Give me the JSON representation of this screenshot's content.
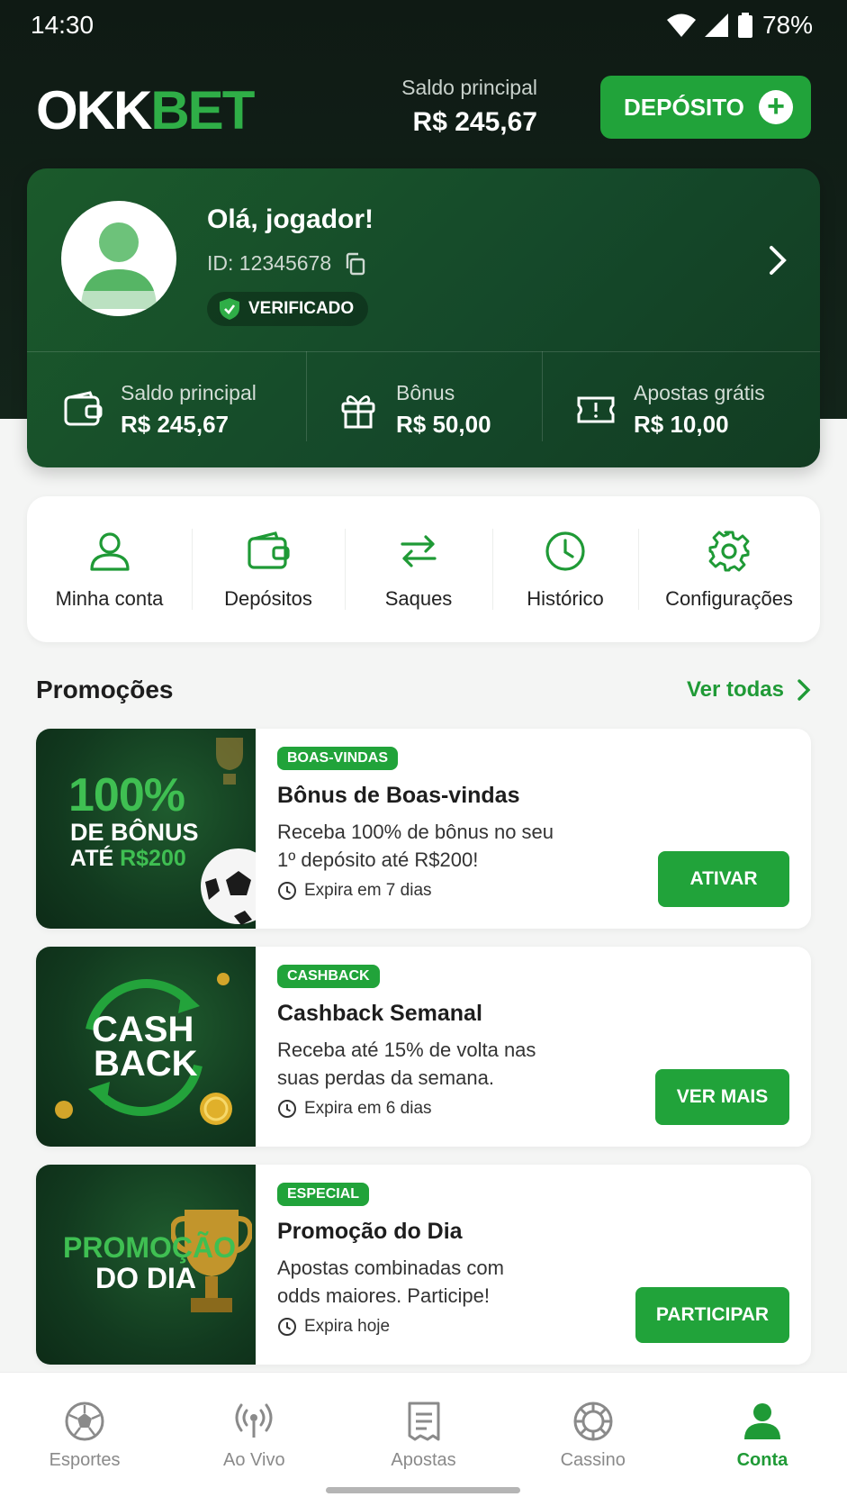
{
  "status_bar": {
    "time": "14:30",
    "battery": "78%"
  },
  "brand": {
    "logo_part1": "OKK",
    "logo_part2": "BET",
    "accent_color": "#21a33a",
    "header_color": "#13241a"
  },
  "header": {
    "balance_label": "Saldo principal",
    "balance_value": "R$ 245,67",
    "deposit_label": "DEPÓSITO"
  },
  "profile": {
    "greeting": "Olá, jogador!",
    "id": "ID: 12345678",
    "verified": "VERIFICADO",
    "wallets": [
      {
        "label": "Saldo principal",
        "value": "R$ 245,67",
        "icon": "wallet-icon"
      },
      {
        "label": "Bônus",
        "value": "R$ 50,00",
        "icon": "gift-icon"
      },
      {
        "label": "Apostas grátis",
        "value": "R$ 10,00",
        "icon": "ticket-icon"
      }
    ]
  },
  "menu": [
    {
      "label": "Minha conta",
      "icon": "user-icon"
    },
    {
      "label": "Depósitos",
      "icon": "wallet-icon"
    },
    {
      "label": "Saques",
      "icon": "transfer-arrows-icon"
    },
    {
      "label": "Histórico",
      "icon": "clock-icon"
    },
    {
      "label": "Configurações",
      "icon": "gear-icon"
    }
  ],
  "promotions": {
    "title": "Promoções",
    "see_all": "Ver todas",
    "items": [
      {
        "tag": "BOAS-VINDAS",
        "title": "Bônus de Boas-vindas",
        "description": "Receba 100% de bônus no seu 1º depósito até R$200!",
        "expires": "Expira em 7 dias",
        "button": "ATIVAR",
        "image_line1": "100%",
        "image_line2": "DE BÔNUS",
        "image_line3a": "ATÉ ",
        "image_line3b": "R$200"
      },
      {
        "tag": "CASHBACK",
        "title": "Cashback Semanal",
        "description": "Receba até 15% de volta nas suas perdas da semana.",
        "expires": "Expira em 6 dias",
        "button": "VER MAIS",
        "image_line1": "CASH",
        "image_line2": "BACK"
      },
      {
        "tag": "ESPECIAL",
        "title": "Promoção do Dia",
        "description": "Apostas combinadas com odds maiores. Participe!",
        "expires": "Expira hoje",
        "button": "PARTICIPAR",
        "image_line1": "PROMOÇÃO",
        "image_line2": "DO DIA"
      }
    ]
  },
  "bottom_nav": [
    {
      "label": "Esportes",
      "icon": "soccer-ball-icon"
    },
    {
      "label": "Ao Vivo",
      "icon": "live-broadcast-icon"
    },
    {
      "label": "Apostas",
      "icon": "bet-slip-icon"
    },
    {
      "label": "Cassino",
      "icon": "casino-chip-icon"
    },
    {
      "label": "Conta",
      "icon": "user-icon",
      "active": true
    }
  ]
}
